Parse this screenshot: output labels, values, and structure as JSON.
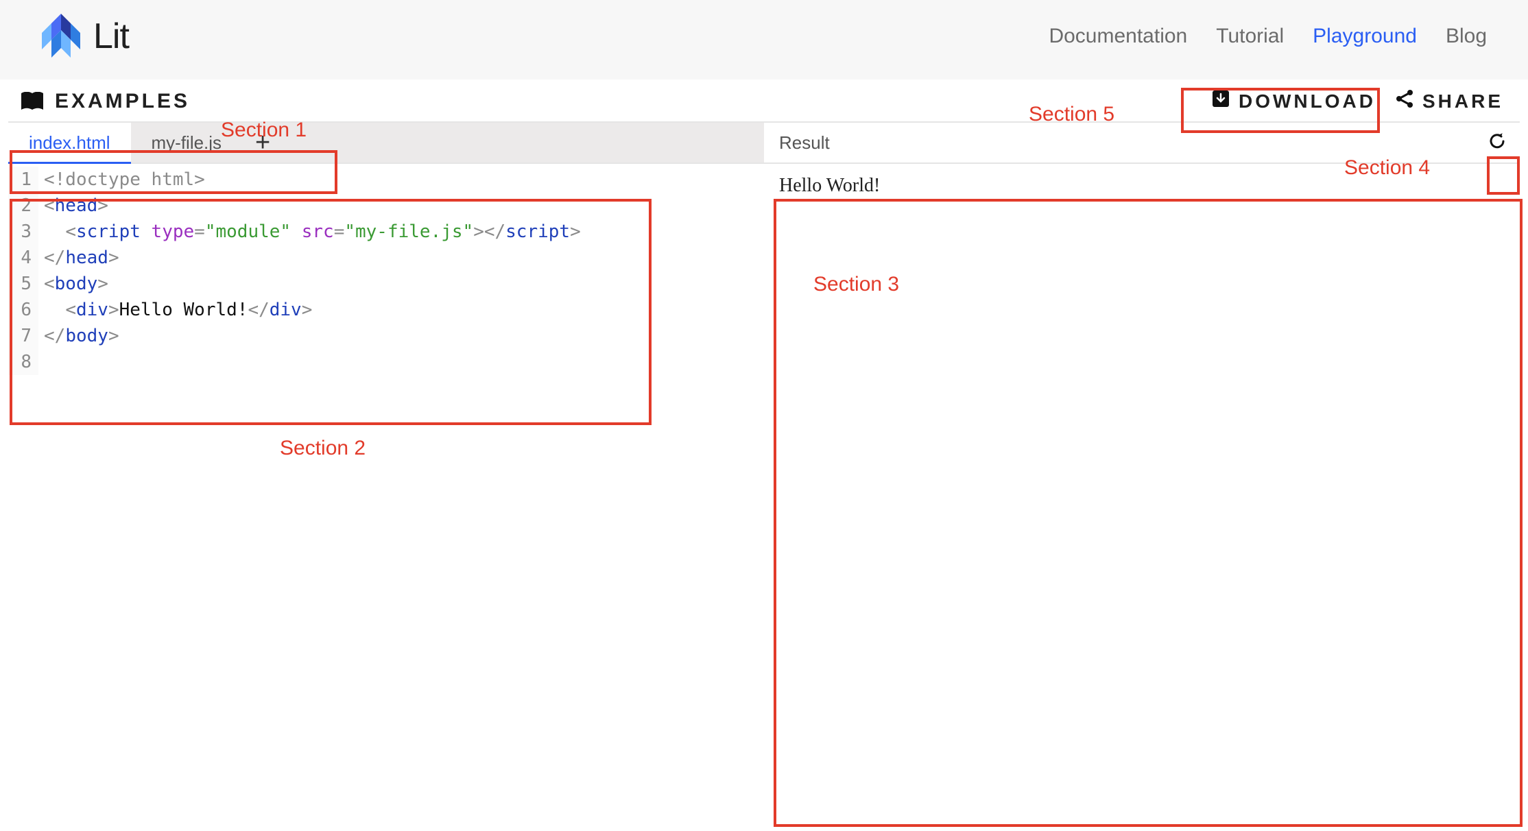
{
  "brand": {
    "name": "Lit"
  },
  "nav": {
    "items": [
      {
        "label": "Documentation",
        "active": false
      },
      {
        "label": "Tutorial",
        "active": false
      },
      {
        "label": "Playground",
        "active": true
      },
      {
        "label": "Blog",
        "active": false
      }
    ]
  },
  "toolbar": {
    "examples_label": "EXAMPLES",
    "download_label": "DOWNLOAD",
    "share_label": "SHARE"
  },
  "tabs": {
    "items": [
      {
        "label": "index.html",
        "active": true
      },
      {
        "label": "my-file.js",
        "active": false
      }
    ],
    "add_tooltip": "+"
  },
  "editor": {
    "line_numbers": [
      "1",
      "2",
      "3",
      "4",
      "5",
      "6",
      "7",
      "8"
    ],
    "code_lines": [
      [
        {
          "t": "bracket",
          "v": "<"
        },
        {
          "t": "doc",
          "v": "!doctype html"
        },
        {
          "t": "bracket",
          "v": ">"
        }
      ],
      [
        {
          "t": "bracket",
          "v": "<"
        },
        {
          "t": "tag",
          "v": "head"
        },
        {
          "t": "bracket",
          "v": ">"
        }
      ],
      [
        {
          "t": "text",
          "v": "  "
        },
        {
          "t": "bracket",
          "v": "<"
        },
        {
          "t": "tag",
          "v": "script"
        },
        {
          "t": "text",
          "v": " "
        },
        {
          "t": "attr",
          "v": "type"
        },
        {
          "t": "bracket",
          "v": "="
        },
        {
          "t": "str",
          "v": "\"module\""
        },
        {
          "t": "text",
          "v": " "
        },
        {
          "t": "attr",
          "v": "src"
        },
        {
          "t": "bracket",
          "v": "="
        },
        {
          "t": "str",
          "v": "\"my-file.js\""
        },
        {
          "t": "bracket",
          "v": ">"
        },
        {
          "t": "bracket",
          "v": "</"
        },
        {
          "t": "tag",
          "v": "script"
        },
        {
          "t": "bracket",
          "v": ">"
        }
      ],
      [
        {
          "t": "bracket",
          "v": "</"
        },
        {
          "t": "tag",
          "v": "head"
        },
        {
          "t": "bracket",
          "v": ">"
        }
      ],
      [
        {
          "t": "bracket",
          "v": "<"
        },
        {
          "t": "tag",
          "v": "body"
        },
        {
          "t": "bracket",
          "v": ">"
        }
      ],
      [
        {
          "t": "text",
          "v": "  "
        },
        {
          "t": "bracket",
          "v": "<"
        },
        {
          "t": "tag",
          "v": "div"
        },
        {
          "t": "bracket",
          "v": ">"
        },
        {
          "t": "text",
          "v": "Hello World!"
        },
        {
          "t": "bracket",
          "v": "</"
        },
        {
          "t": "tag",
          "v": "div"
        },
        {
          "t": "bracket",
          "v": ">"
        }
      ],
      [
        {
          "t": "bracket",
          "v": "</"
        },
        {
          "t": "tag",
          "v": "body"
        },
        {
          "t": "bracket",
          "v": ">"
        }
      ],
      []
    ]
  },
  "result": {
    "title": "Result",
    "output": "Hello World!"
  },
  "annotations": {
    "section1": "Section 1",
    "section2": "Section 2",
    "section3": "Section 3",
    "section4": "Section 4",
    "section5": "Section 5"
  }
}
